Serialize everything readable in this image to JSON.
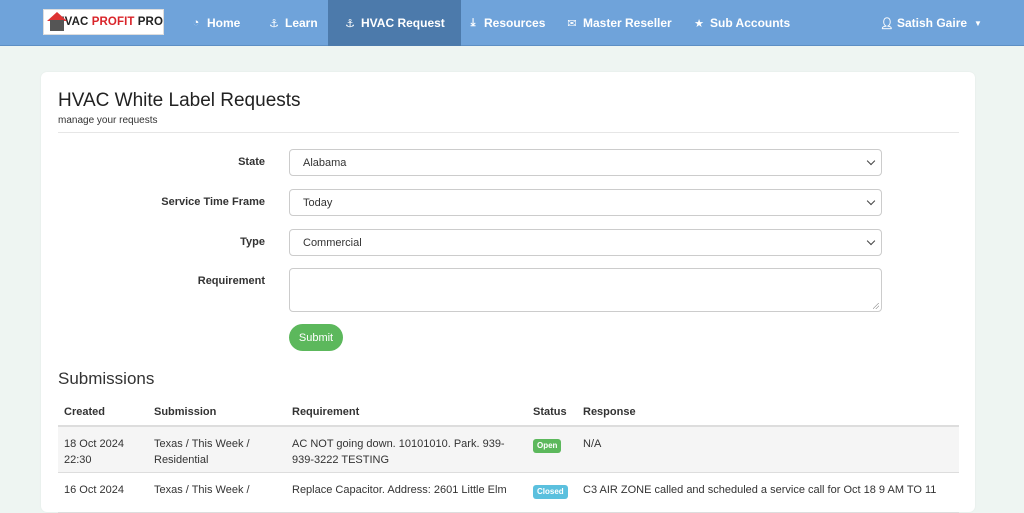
{
  "navbar": {
    "logo": {
      "part1": "HVAC ",
      "part2": "PROFIT",
      "part3": " PRO"
    },
    "items": [
      {
        "label": "Home",
        "icon": "dashboard-icon"
      },
      {
        "label": "Learn",
        "icon": "anchor-icon"
      },
      {
        "label": "HVAC Request",
        "icon": "anchor-icon",
        "active": true
      },
      {
        "label": "Resources",
        "icon": "download-icon"
      },
      {
        "label": "Master Reseller",
        "icon": "envelope-icon"
      },
      {
        "label": "Sub Accounts",
        "icon": "star-icon"
      }
    ],
    "user": {
      "label": "Satish Gaire",
      "icon": "user-icon"
    }
  },
  "page": {
    "title": "HVAC White Label Requests",
    "subtitle": "manage your requests"
  },
  "form": {
    "state": {
      "label": "State",
      "value": "Alabama"
    },
    "time_frame": {
      "label": "Service Time Frame",
      "value": "Today"
    },
    "type": {
      "label": "Type",
      "value": "Commercial"
    },
    "requirement": {
      "label": "Requirement",
      "value": ""
    },
    "submit_label": "Submit"
  },
  "submissions": {
    "title": "Submissions",
    "columns": [
      "Created",
      "Submission",
      "Requirement",
      "Status",
      "Response"
    ],
    "rows": [
      {
        "created_line1": "18 Oct 2024",
        "created_line2": "22:30",
        "submission_line1": "Texas / This Week /",
        "submission_line2": "Residential",
        "requirement_line1": "AC NOT going down. 10101010. Park. 939-",
        "requirement_line2": "939-3222 TESTING",
        "status": "Open",
        "response": "N/A"
      },
      {
        "created_line1": "16 Oct 2024",
        "submission_line1": "Texas / This Week /",
        "requirement_line1": "Replace Capacitor. Address: 2601 Little Elm",
        "status": "Closed",
        "response": "C3 AIR ZONE called and scheduled a service call for Oct 18 9 AM TO 11"
      }
    ]
  },
  "colors": {
    "navbar": "#6fa3da",
    "navbar_active": "#4c7aab",
    "submit": "#5cb85c",
    "badge_open": "#5cb85c",
    "badge_closed": "#5bc0de"
  }
}
